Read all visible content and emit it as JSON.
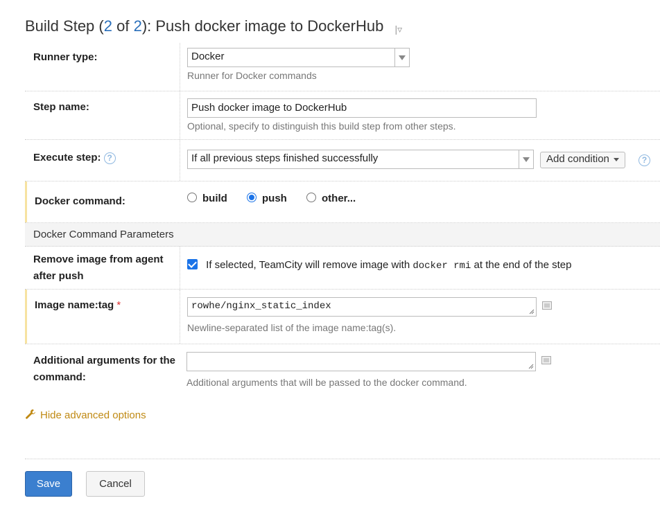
{
  "header": {
    "title_prefix": "Build Step (",
    "step_current": "2",
    "of_label": " of ",
    "step_total": "2",
    "title_suffix": "): Push docker image to DockerHub",
    "dropdown_icon": "chevron-down-icon"
  },
  "runner": {
    "label": "Runner type:",
    "value": "Docker",
    "hint": "Runner for Docker commands"
  },
  "step_name": {
    "label": "Step name:",
    "value": "Push docker image to DockerHub",
    "hint": "Optional, specify to distinguish this build step from other steps."
  },
  "execute": {
    "label": "Execute step:",
    "value": "If all previous steps finished successfully",
    "add_condition": "Add condition"
  },
  "docker_command": {
    "label": "Docker command:",
    "options": [
      "build",
      "push",
      "other..."
    ],
    "selected": "push"
  },
  "section_title": "Docker Command Parameters",
  "remove_image": {
    "label": "Remove image from agent after push",
    "checked": true,
    "text_before": "If selected, TeamCity will remove image with ",
    "code": "docker rmi",
    "text_after": " at the end of the step"
  },
  "image_tag": {
    "label": "Image name:tag",
    "required_mark": "*",
    "value": "rowhe/nginx_static_index",
    "hint": "Newline-separated list of the image name:tag(s)."
  },
  "additional_args": {
    "label": "Additional arguments for the command:",
    "value": "",
    "hint": "Additional arguments that will be passed to the docker command."
  },
  "advanced_toggle": "Hide advanced options",
  "buttons": {
    "save": "Save",
    "cancel": "Cancel"
  },
  "colors": {
    "accent": "#3b7fcf",
    "link_orange": "#c08a14",
    "highlight_bar": "#f7e3a1",
    "radio_blue": "#1a73e8"
  }
}
